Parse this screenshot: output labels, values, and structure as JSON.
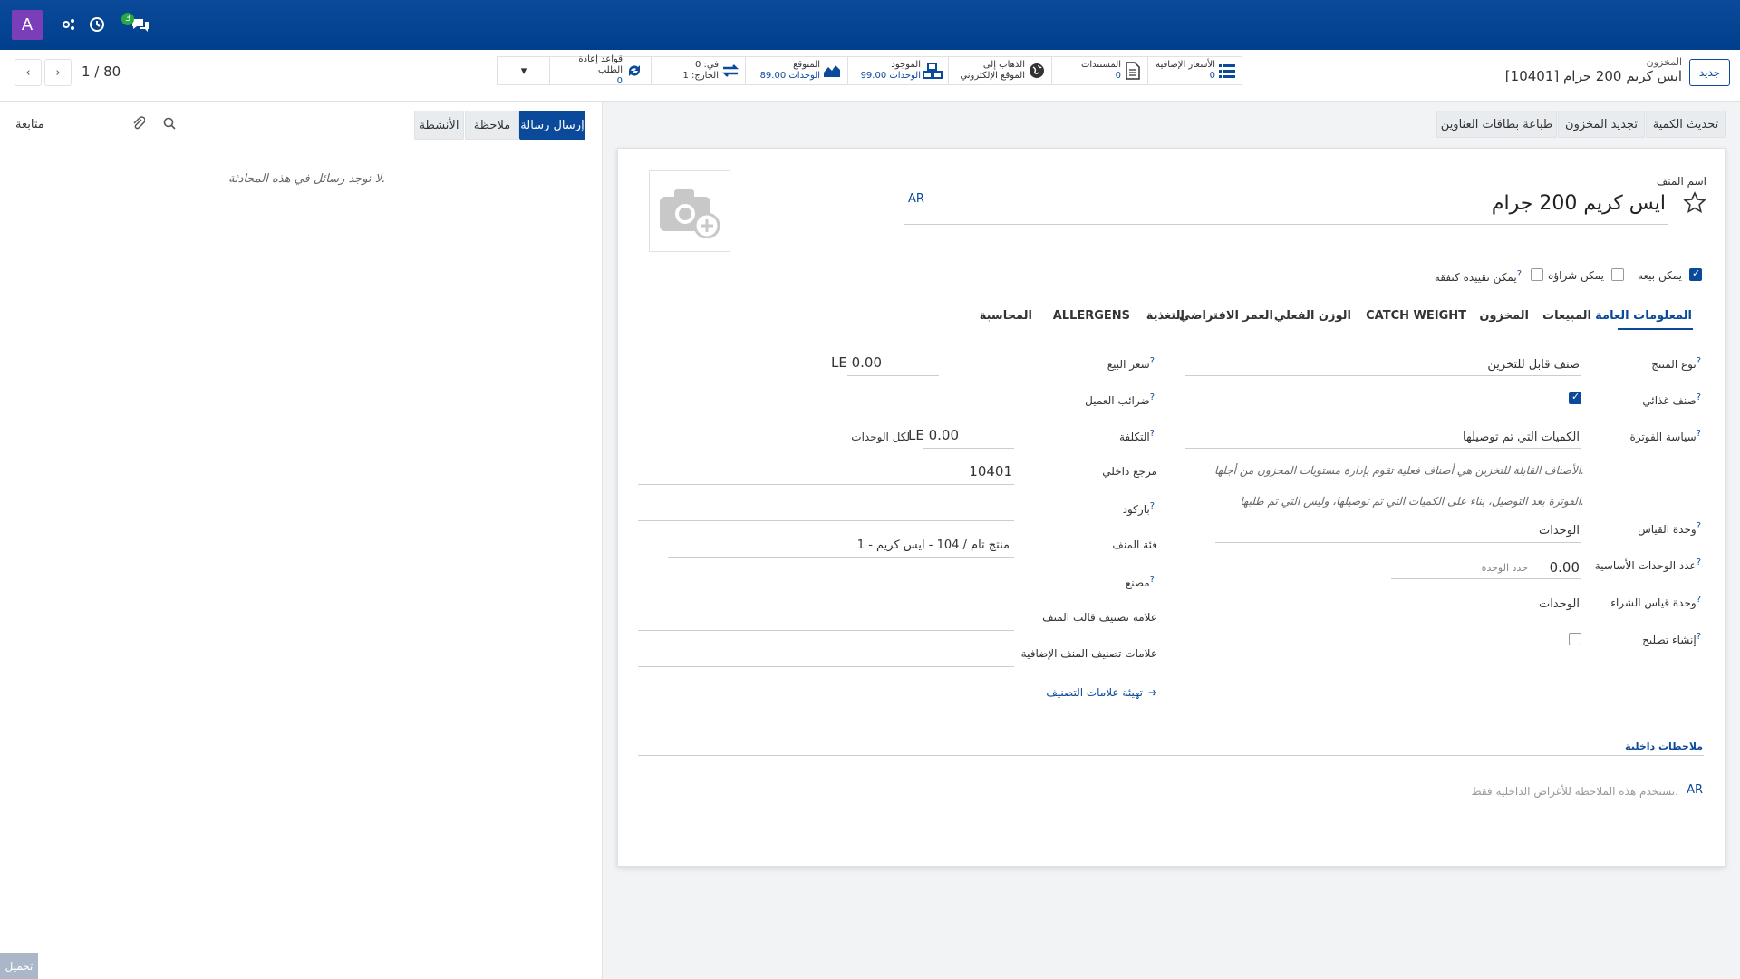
{
  "navbar": {
    "avatar_letter": "A",
    "chat_badge": "3",
    "icons": [
      "activity-icon",
      "clock-icon",
      "chat-icon"
    ]
  },
  "pager": {
    "text": "1 / 80"
  },
  "breadcrumb": {
    "parent": "المخزون",
    "current": "[10401] ايس كريم 200 جرام"
  },
  "new_button": "جديد",
  "smart_buttons": [
    {
      "title": "الأسعار الإضافية",
      "value": "0",
      "icon": "list-icon"
    },
    {
      "title": "المستندات",
      "value": "0",
      "icon": "document-icon"
    },
    {
      "title": "الذهاب إلى",
      "value": "الموقع الإلكتروني",
      "icon": "globe-icon"
    },
    {
      "title": "الموجود",
      "value": "99.00 الوحدات",
      "icon": "cubes-icon"
    },
    {
      "title": "المتوقع",
      "value": "89.00 الوحدات",
      "icon": "chart-area-icon"
    },
    {
      "title": "في: 0",
      "value": "الخارج: 1",
      "icon": "exchange-icon"
    },
    {
      "title": "قواعد إعادة الطلب",
      "value": "0",
      "icon": "refresh-icon"
    }
  ],
  "actions": {
    "update_qty": "تحديث الكمية",
    "replenish": "تجديد المخزون",
    "print_labels": "طباعة بطاقات العناوين"
  },
  "chatter": {
    "send_message": "إرسال رسالة",
    "log_note": "ملاحظة",
    "activities": "الأنشطة",
    "follow": "متابعة",
    "empty": "لا توجد رسائل في هذه المحادثة.",
    "loading": "تحميل"
  },
  "form": {
    "name_label": "اسم المنف",
    "name_value": "ايس كريم 200 جرام",
    "lang": "AR",
    "options": {
      "can_sell": "يمكن بيعه",
      "can_purchase": "يمكن شراؤه",
      "can_expense": "يمكن تقييده كنفقة"
    },
    "tabs": [
      "المعلومات العامة",
      "المبيعات",
      "المخزون",
      "CATCH WEIGHT",
      "الوزن الفعلي",
      "العمر الافتراضي",
      "التغذية",
      "ALLERGENS",
      "المحاسبة"
    ],
    "right": {
      "product_type_label": "نوع المنتج",
      "product_type_value": "صنف قابل للتخزين",
      "food_label": "صنف غذائي",
      "invoice_policy_label": "سياسة الفوترة",
      "invoice_policy_value": "الكميات التي تم توصيلها",
      "help1": "الأصناف القابلة للتخزين هي أصناف فعلية تقوم بإدارة مستويات المخزون من أجلها.",
      "help2": "الفوترة بعد التوصيل، بناء على الكميات التي تم توصيلها، وليس التي تم طلبها.",
      "uom_label": "وحدة القياس",
      "uom_value": "الوحدات",
      "base_units_label": "عدد الوحدات الأساسية",
      "base_units_value": "0.00",
      "base_units_placeholder": "حدد الوحدة",
      "purchase_uom_label": "وحدة قياس الشراء",
      "purchase_uom_value": "الوحدات",
      "create_repair_label": "إنشاء تصليح"
    },
    "left": {
      "sale_price_label": "سعر البيع",
      "sale_price_value": "LE 0.00",
      "customer_taxes_label": "ضرائب العميل",
      "cost_label": "التكلفة",
      "cost_value": "LE 0.00",
      "cost_suffix": "لكل الوحدات",
      "internal_ref_label": "مرجع داخلي",
      "internal_ref_value": "10401",
      "barcode_label": "باركود",
      "category_label": "فئة المنف",
      "category_value": "1 - منتج تام / 104 - ايس كريم",
      "manufacturer_label": "مصنع",
      "template_tag_label": "علامة تصنيف قالب المنف",
      "extra_tags_label": "علامات تصنيف المنف الإضافية",
      "configure_tags": "تهيئة علامات التصنيف"
    },
    "internal_notes_label": "ملاحظات داخلية",
    "internal_notes_placeholder": "تستخدم هذه الملاحظة للأغراض الداخلية فقط."
  },
  "colors": {
    "brand": "#0b4a9a",
    "avatar": "#7a3fb8",
    "badge": "#28a745"
  }
}
